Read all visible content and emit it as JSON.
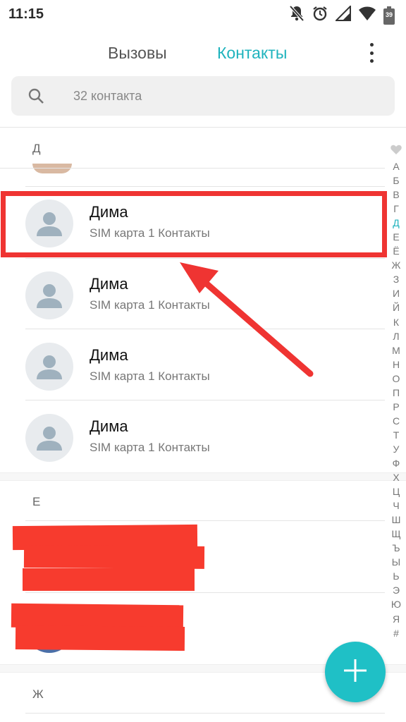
{
  "status_bar": {
    "time": "11:15",
    "battery": "39",
    "icons": [
      "notifications-off-icon",
      "alarm-icon",
      "signal-icon",
      "wifi-icon",
      "battery-icon"
    ]
  },
  "tabs": {
    "calls": "Вызовы",
    "contacts": "Контакты",
    "active": "contacts"
  },
  "search": {
    "placeholder": "32 контакта"
  },
  "sections": [
    {
      "letter": "Д",
      "contacts": [
        {
          "name": "Дима",
          "subtitle": "SIM карта 1 Контакты",
          "highlighted": true
        },
        {
          "name": "Дима",
          "subtitle": "SIM карта 1 Контакты"
        },
        {
          "name": "Дима",
          "subtitle": "SIM карта 1 Контакты"
        },
        {
          "name": "Дима",
          "subtitle": "SIM карта 1 Контакты"
        }
      ]
    },
    {
      "letter": "Е",
      "contacts": []
    },
    {
      "letter": "Ж",
      "contacts": []
    }
  ],
  "alphabet_index": [
    "А",
    "Б",
    "В",
    "Г",
    "Д",
    "Е",
    "Ё",
    "Ж",
    "З",
    "И",
    "Й",
    "К",
    "Л",
    "М",
    "Н",
    "О",
    "П",
    "Р",
    "С",
    "Т",
    "У",
    "Ф",
    "Х",
    "Ц",
    "Ч",
    "Ш",
    "Щ",
    "Ъ",
    "Ы",
    "Ь",
    "Э",
    "Ю",
    "Я",
    "#"
  ],
  "alphabet_active": "Д",
  "colors": {
    "accent": "#1fb3bd",
    "fab": "#1fc0c6",
    "annotation_red": "#ef3432"
  },
  "fab": {
    "icon": "plus-icon"
  }
}
